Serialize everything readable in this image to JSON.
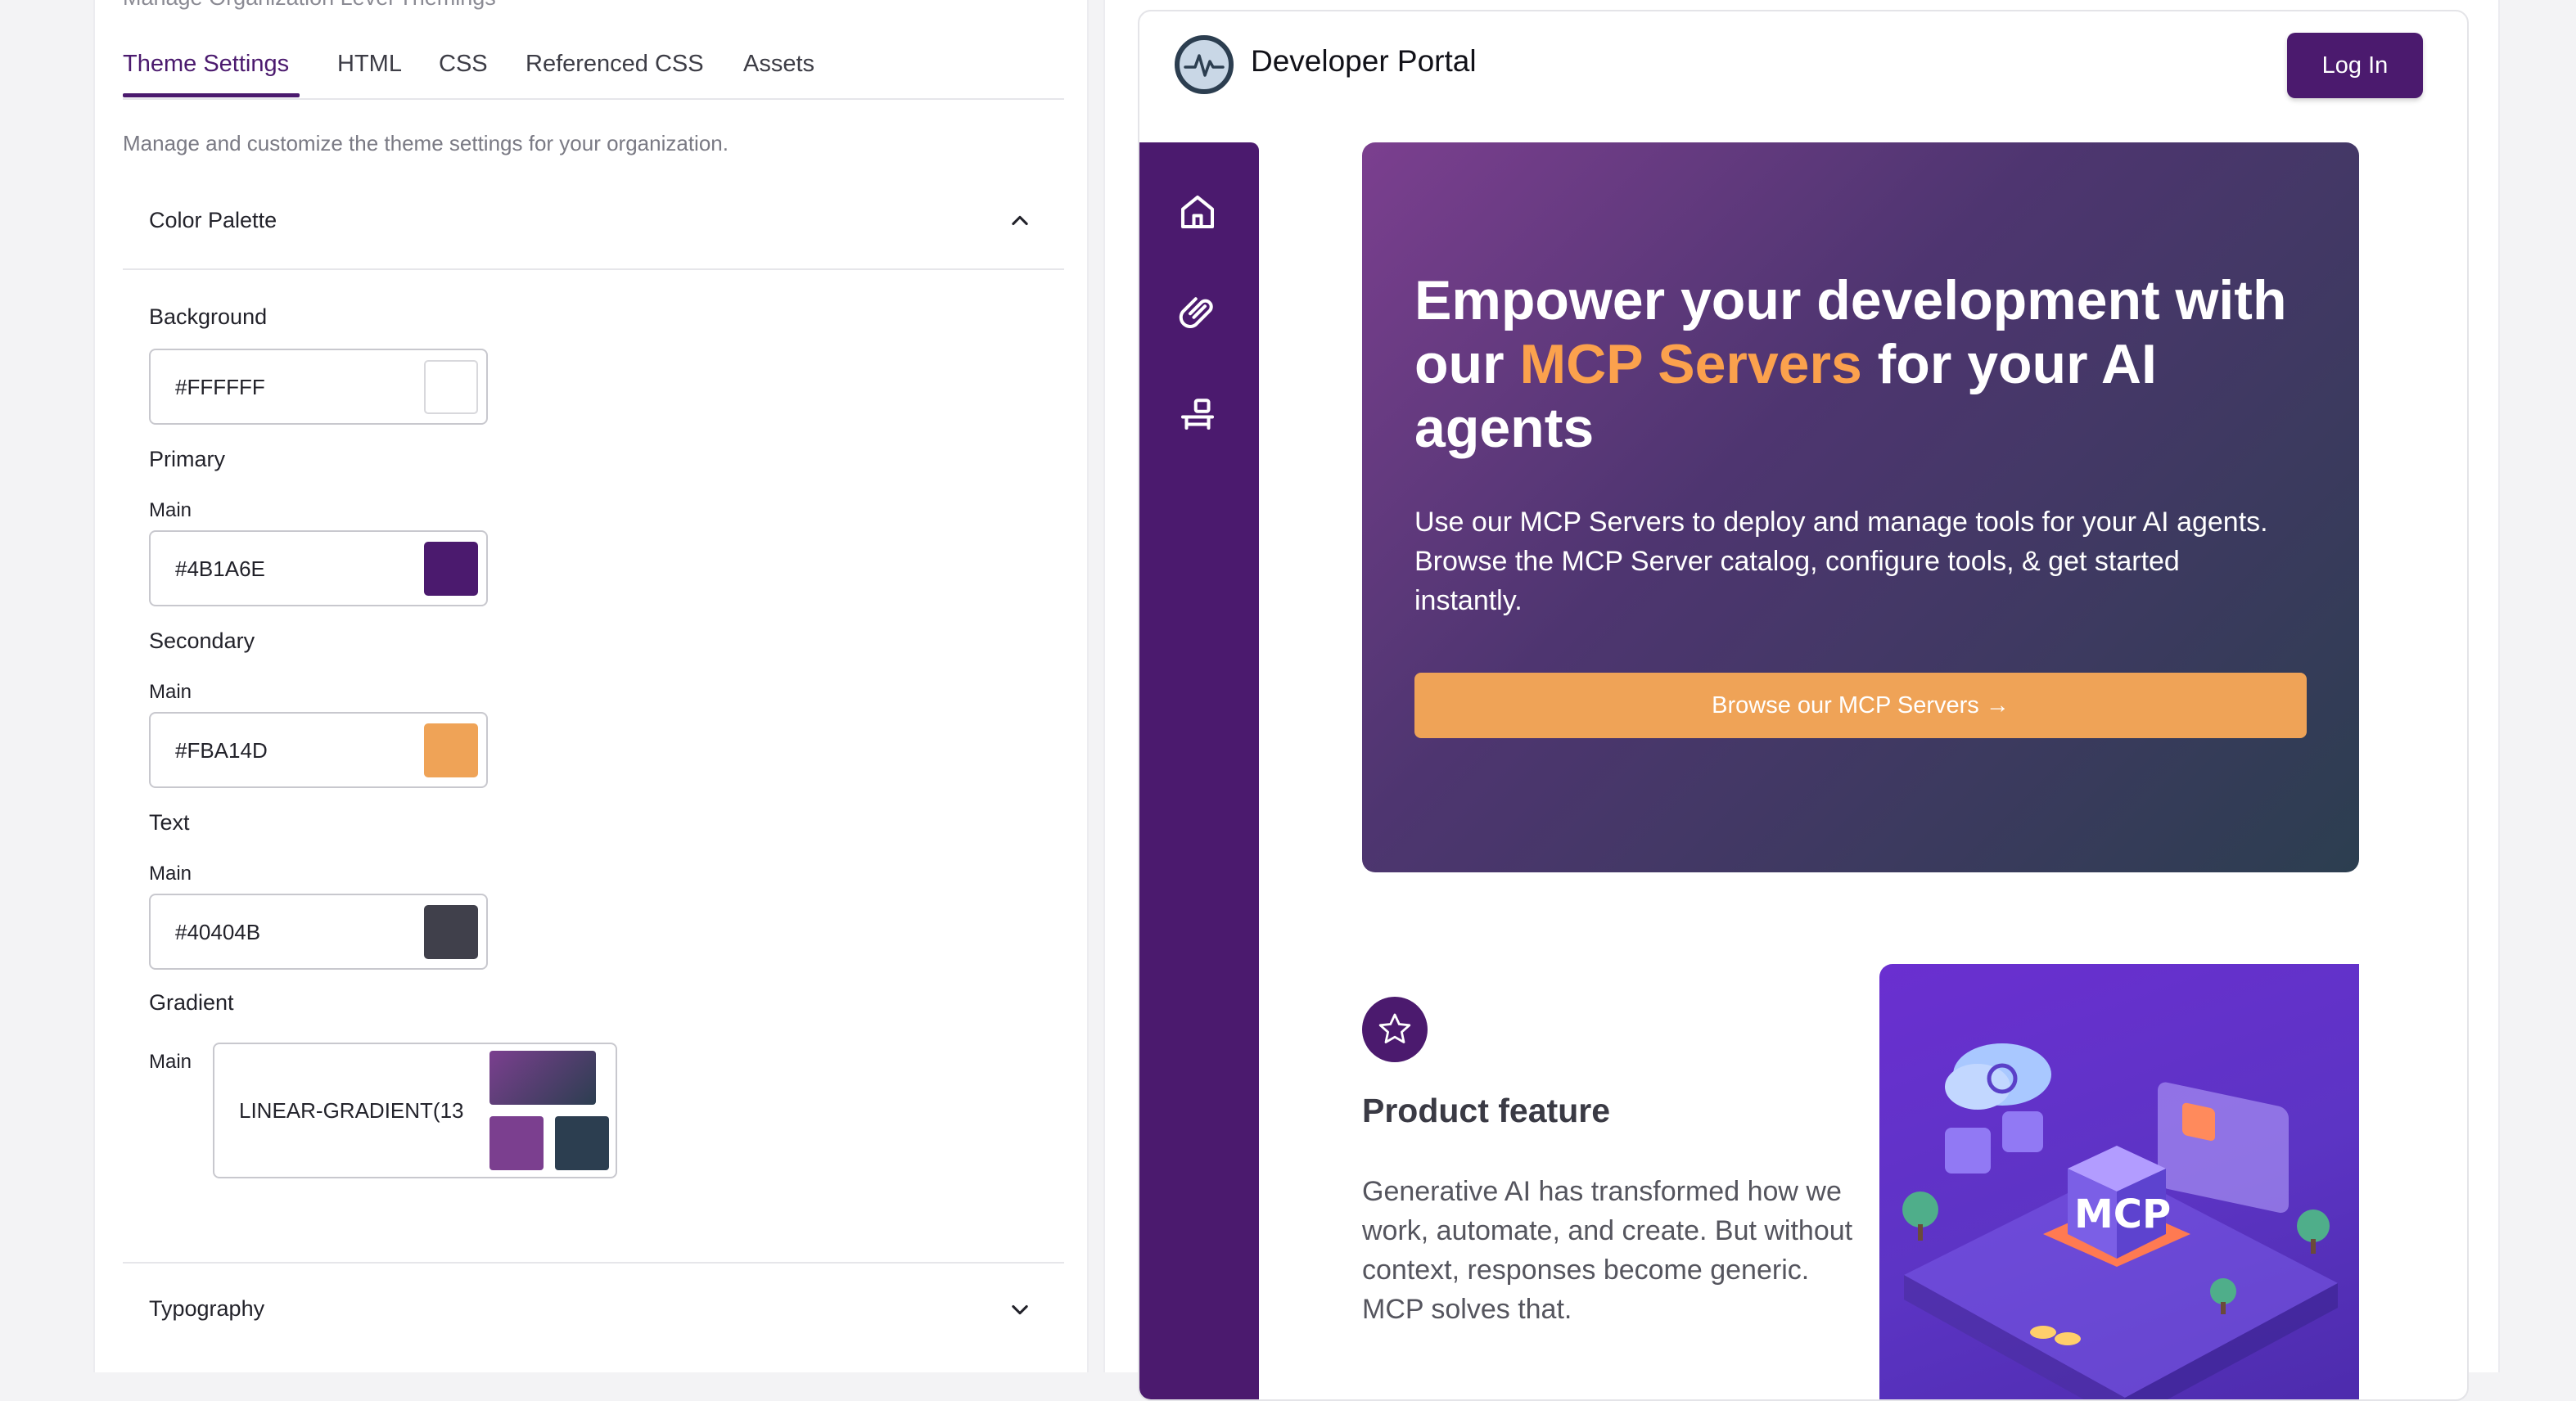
{
  "left_panel": {
    "cut_heading": "Manage Organization Level Themings",
    "tabs": [
      {
        "label": "Theme Settings",
        "active": true
      },
      {
        "label": "HTML",
        "active": false
      },
      {
        "label": "CSS",
        "active": false
      },
      {
        "label": "Referenced CSS",
        "active": false
      },
      {
        "label": "Assets",
        "active": false
      }
    ],
    "description": "Manage and customize the theme settings for your organization.",
    "color_palette": {
      "title": "Color Palette",
      "expanded": true,
      "toggle_icon": "chevron-up-icon",
      "background": {
        "label": "Background",
        "value": "#FFFFFF",
        "swatch": "#FFFFFF"
      },
      "primary": {
        "label": "Primary",
        "sub_label": "Main",
        "value": "#4B1A6E",
        "swatch": "#4B1A6E"
      },
      "secondary": {
        "label": "Secondary",
        "sub_label": "Main",
        "value": "#FBA14D",
        "swatch": "#FBA14D"
      },
      "text": {
        "label": "Text",
        "sub_label": "Main",
        "value": "#40404B",
        "swatch": "#40404B"
      },
      "gradient": {
        "label": "Gradient",
        "sub_label": "Main",
        "value": "LINEAR-GRADIENT(13",
        "stop_1": "#7B3F8F",
        "stop_2": "#2C3E50"
      }
    },
    "typography": {
      "title": "Typography",
      "expanded": false,
      "toggle_icon": "chevron-down-icon"
    }
  },
  "preview": {
    "header": {
      "title": "Developer Portal",
      "login_label": "Log In",
      "logo_icon": "pulse-logo-icon"
    },
    "side_nav": [
      {
        "icon": "home-icon"
      },
      {
        "icon": "paperclip-icon"
      },
      {
        "icon": "desk-icon"
      }
    ],
    "hero": {
      "title_part_1": "Empower your development with our ",
      "title_accent": "MCP Servers",
      "title_part_2": " for your AI agents",
      "description": "Use our MCP Servers to deploy and manage tools for your AI agents. Browse the MCP Server catalog, configure tools, & get started instantly.",
      "button_label": "Browse our MCP Servers →"
    },
    "feature": {
      "icon": "star-icon",
      "title": "Product feature",
      "description": "Generative AI has transformed how we work, automate, and create. But without context, responses become generic. MCP solves that.",
      "illustration_text": "MCP"
    }
  },
  "colors": {
    "primary": "#4B1A6E",
    "secondary": "#FBA14D",
    "text": "#40404B"
  }
}
